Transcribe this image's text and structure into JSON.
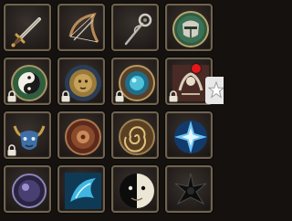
{
  "inventory": {
    "rows": [
      [
        {
          "item": "sword-icon",
          "locked": false
        },
        {
          "item": "bow-icon",
          "locked": false
        },
        {
          "item": "staff-icon",
          "locked": false
        },
        {
          "item": "helm-shield-icon",
          "locked": false
        }
      ],
      [
        {
          "item": "yin-yang-icon",
          "locked": true
        },
        {
          "item": "golden-lion-icon",
          "locked": true
        },
        {
          "item": "blue-gem-icon",
          "locked": true
        },
        {
          "item": "bone-creature-icon",
          "locked": true,
          "notification": true
        }
      ],
      [
        {
          "item": "horned-mask-icon",
          "locked": true
        },
        {
          "item": "bronze-medallion-icon",
          "locked": false
        },
        {
          "item": "golden-spiral-icon",
          "locked": false
        },
        {
          "item": "ice-crystal-icon",
          "locked": false
        }
      ],
      [
        {
          "item": "dark-orb-icon",
          "locked": false
        },
        {
          "item": "ice-wing-icon",
          "locked": false
        },
        {
          "item": "black-white-face-icon",
          "locked": false
        },
        {
          "item": "shadow-sigil-icon",
          "locked": false
        }
      ]
    ]
  },
  "side_tab": {
    "icon": "star-icon"
  },
  "colors": {
    "frame": "#6f6350",
    "slot_bg": "#231e1b",
    "badge": "#e3171b",
    "tab_bg": "#e8e8e8"
  }
}
